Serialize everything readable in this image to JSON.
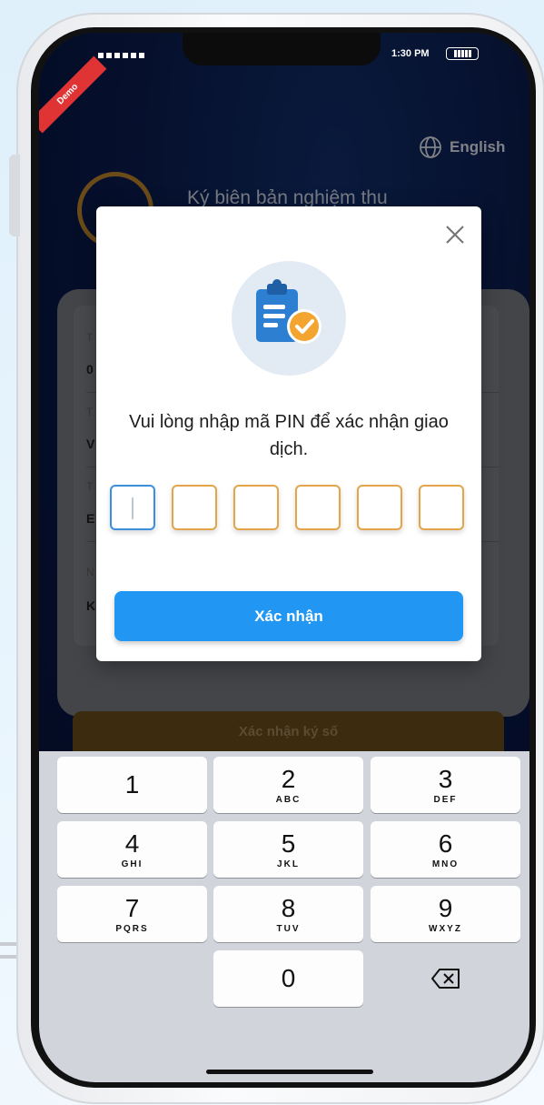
{
  "status_bar": {
    "time": "1:30 PM"
  },
  "ribbon": {
    "label": "Demo"
  },
  "header": {
    "language_label": "English",
    "title": "Ký biên bản nghiệm thu"
  },
  "card": {
    "row_letters": [
      "0",
      "V",
      "E",
      "K"
    ]
  },
  "bottom_button": {
    "label": "Xác nhận ký số"
  },
  "modal": {
    "message": "Vui lòng nhập mã PIN để xác nhận giao dịch.",
    "pin_values": [
      "",
      "",
      "",
      "",
      "",
      ""
    ],
    "confirm_label": "Xác nhận",
    "icon": "clipboard-check-icon"
  },
  "keypad": {
    "keys": [
      {
        "num": "1",
        "letters": ""
      },
      {
        "num": "2",
        "letters": "ABC"
      },
      {
        "num": "3",
        "letters": "DEF"
      },
      {
        "num": "4",
        "letters": "GHI"
      },
      {
        "num": "5",
        "letters": "JKL"
      },
      {
        "num": "6",
        "letters": "MNO"
      },
      {
        "num": "7",
        "letters": "PQRS"
      },
      {
        "num": "8",
        "letters": "TUV"
      },
      {
        "num": "9",
        "letters": "WXYZ"
      },
      {
        "num": "0",
        "letters": ""
      }
    ]
  },
  "colors": {
    "primary": "#2196f3",
    "accent": "#e4a44a",
    "header_bg": "#0a1b4e"
  }
}
